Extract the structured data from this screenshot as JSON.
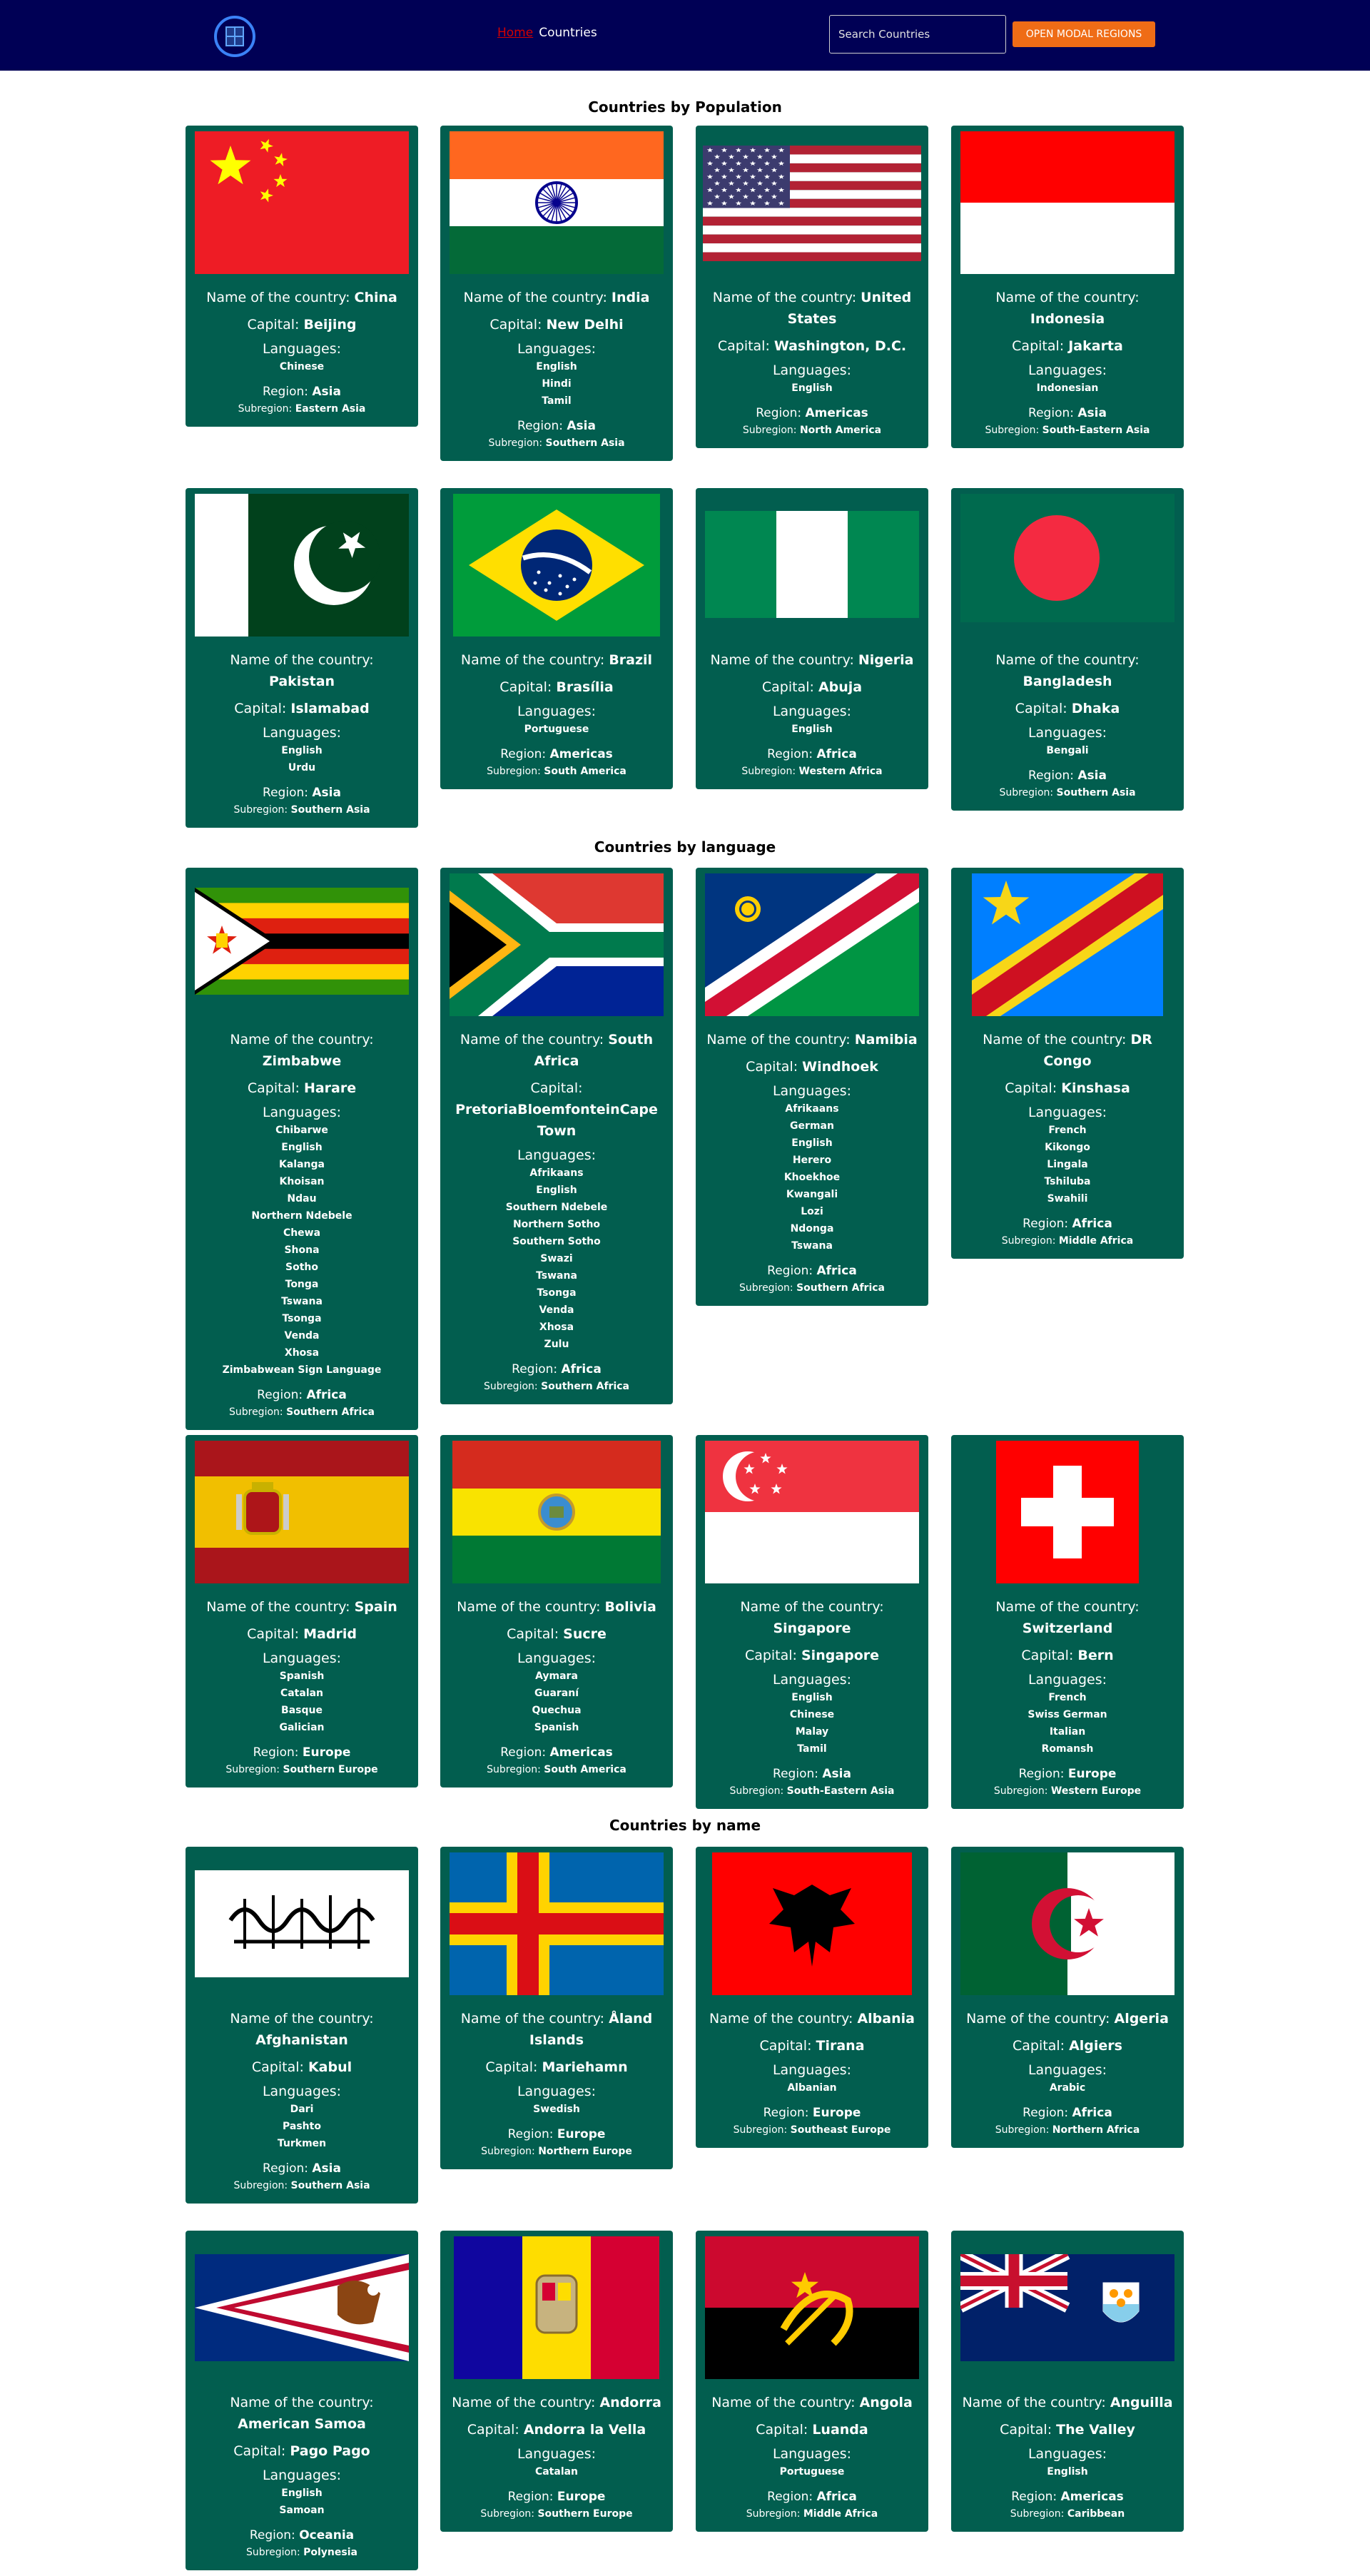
{
  "navbar": {
    "home_label": "Home",
    "countries_label": "Countries",
    "search_placeholder": "Search Countries",
    "modal_button_label": "OPEN MODAL REGIONS",
    "bg_color": "#000055",
    "accent_color": "#ef6c16"
  },
  "labels": {
    "name_prefix": "Name of the country: ",
    "capital_prefix": "Capital: ",
    "languages": "Languages:",
    "region_prefix": "Region: ",
    "subregion_prefix": "Subregion: "
  },
  "sections": [
    {
      "title": "Countries by Population",
      "rows": [
        [
          {
            "flag": "china",
            "name": "China",
            "capital": "Beijing",
            "languages": [
              "Chinese"
            ],
            "region": "Asia",
            "subregion": "Eastern Asia"
          },
          {
            "flag": "india",
            "name": "India",
            "capital": "New Delhi",
            "languages": [
              "English",
              "Hindi",
              "Tamil"
            ],
            "region": "Asia",
            "subregion": "Southern Asia"
          },
          {
            "flag": "usa",
            "name": "United States",
            "capital": "Washington, D.C.",
            "languages": [
              "English"
            ],
            "region": "Americas",
            "subregion": "North America"
          },
          {
            "flag": "indonesia",
            "name": "Indonesia",
            "capital": "Jakarta",
            "languages": [
              "Indonesian"
            ],
            "region": "Asia",
            "subregion": "South-Eastern Asia"
          }
        ],
        [
          {
            "flag": "pakistan",
            "name": "Pakistan",
            "capital": "Islamabad",
            "languages": [
              "English",
              "Urdu"
            ],
            "region": "Asia",
            "subregion": "Southern Asia"
          },
          {
            "flag": "brazil",
            "name": "Brazil",
            "capital": "Brasília",
            "languages": [
              "Portuguese"
            ],
            "region": "Americas",
            "subregion": "South America"
          },
          {
            "flag": "nigeria",
            "name": "Nigeria",
            "capital": "Abuja",
            "languages": [
              "English"
            ],
            "region": "Africa",
            "subregion": "Western Africa"
          },
          {
            "flag": "bangladesh",
            "name": "Bangladesh",
            "capital": "Dhaka",
            "languages": [
              "Bengali"
            ],
            "region": "Asia",
            "subregion": "Southern Asia"
          }
        ]
      ]
    },
    {
      "title": "Countries by language",
      "rows": [
        [
          {
            "flag": "zimbabwe",
            "name": "Zimbabwe",
            "capital": "Harare",
            "languages": [
              "Chibarwe",
              "English",
              "Kalanga",
              "Khoisan",
              "Ndau",
              "Northern Ndebele",
              "Chewa",
              "Shona",
              "Sotho",
              "Tonga",
              "Tswana",
              "Tsonga",
              "Venda",
              "Xhosa",
              "Zimbabwean Sign Language"
            ],
            "region": "Africa",
            "subregion": "Southern Africa"
          },
          {
            "flag": "southafrica",
            "name": "South Africa",
            "capital": "PretoriaBloemfonteinCape Town",
            "languages": [
              "Afrikaans",
              "English",
              "Southern Ndebele",
              "Northern Sotho",
              "Southern Sotho",
              "Swazi",
              "Tswana",
              "Tsonga",
              "Venda",
              "Xhosa",
              "Zulu"
            ],
            "region": "Africa",
            "subregion": "Southern Africa"
          },
          {
            "flag": "namibia",
            "name": "Namibia",
            "capital": "Windhoek",
            "languages": [
              "Afrikaans",
              "German",
              "English",
              "Herero",
              "Khoekhoe",
              "Kwangali",
              "Lozi",
              "Ndonga",
              "Tswana"
            ],
            "region": "Africa",
            "subregion": "Southern Africa"
          },
          {
            "flag": "drcongo",
            "name": "DR Congo",
            "capital": "Kinshasa",
            "languages": [
              "French",
              "Kikongo",
              "Lingala",
              "Tshiluba",
              "Swahili"
            ],
            "region": "Africa",
            "subregion": "Middle Africa"
          }
        ],
        [
          {
            "flag": "spain",
            "name": "Spain",
            "capital": "Madrid",
            "languages": [
              "Spanish",
              "Catalan",
              "Basque",
              "Galician"
            ],
            "region": "Europe",
            "subregion": "Southern Europe"
          },
          {
            "flag": "bolivia",
            "name": "Bolivia",
            "capital": "Sucre",
            "languages": [
              "Aymara",
              "Guaraní",
              "Quechua",
              "Spanish"
            ],
            "region": "Americas",
            "subregion": "South America"
          },
          {
            "flag": "singapore",
            "name": "Singapore",
            "capital": "Singapore",
            "languages": [
              "English",
              "Chinese",
              "Malay",
              "Tamil"
            ],
            "region": "Asia",
            "subregion": "South-Eastern Asia"
          },
          {
            "flag": "switzerland",
            "name": "Switzerland",
            "capital": "Bern",
            "languages": [
              "French",
              "Swiss German",
              "Italian",
              "Romansh"
            ],
            "region": "Europe",
            "subregion": "Western Europe"
          }
        ]
      ]
    },
    {
      "title": "Countries by name",
      "rows": [
        [
          {
            "flag": "afghanistan",
            "name": "Afghanistan",
            "capital": "Kabul",
            "languages": [
              "Dari",
              "Pashto",
              "Turkmen"
            ],
            "region": "Asia",
            "subregion": "Southern Asia"
          },
          {
            "flag": "aland",
            "name": "Åland Islands",
            "capital": "Mariehamn",
            "languages": [
              "Swedish"
            ],
            "region": "Europe",
            "subregion": "Northern Europe"
          },
          {
            "flag": "albania",
            "name": "Albania",
            "capital": "Tirana",
            "languages": [
              "Albanian"
            ],
            "region": "Europe",
            "subregion": "Southeast Europe"
          },
          {
            "flag": "algeria",
            "name": "Algeria",
            "capital": "Algiers",
            "languages": [
              "Arabic"
            ],
            "region": "Africa",
            "subregion": "Northern Africa"
          }
        ],
        [
          {
            "flag": "americansamoa",
            "name": "American Samoa",
            "capital": "Pago Pago",
            "languages": [
              "English",
              "Samoan"
            ],
            "region": "Oceania",
            "subregion": "Polynesia"
          },
          {
            "flag": "andorra",
            "name": "Andorra",
            "capital": "Andorra la Vella",
            "languages": [
              "Catalan"
            ],
            "region": "Europe",
            "subregion": "Southern Europe"
          },
          {
            "flag": "angola",
            "name": "Angola",
            "capital": "Luanda",
            "languages": [
              "Portuguese"
            ],
            "region": "Africa",
            "subregion": "Middle Africa"
          },
          {
            "flag": "anguilla",
            "name": "Anguilla",
            "capital": "The Valley",
            "languages": [
              "English"
            ],
            "region": "Americas",
            "subregion": "Caribbean"
          }
        ]
      ]
    }
  ],
  "colors": {
    "card_bg": "#025e4f"
  }
}
